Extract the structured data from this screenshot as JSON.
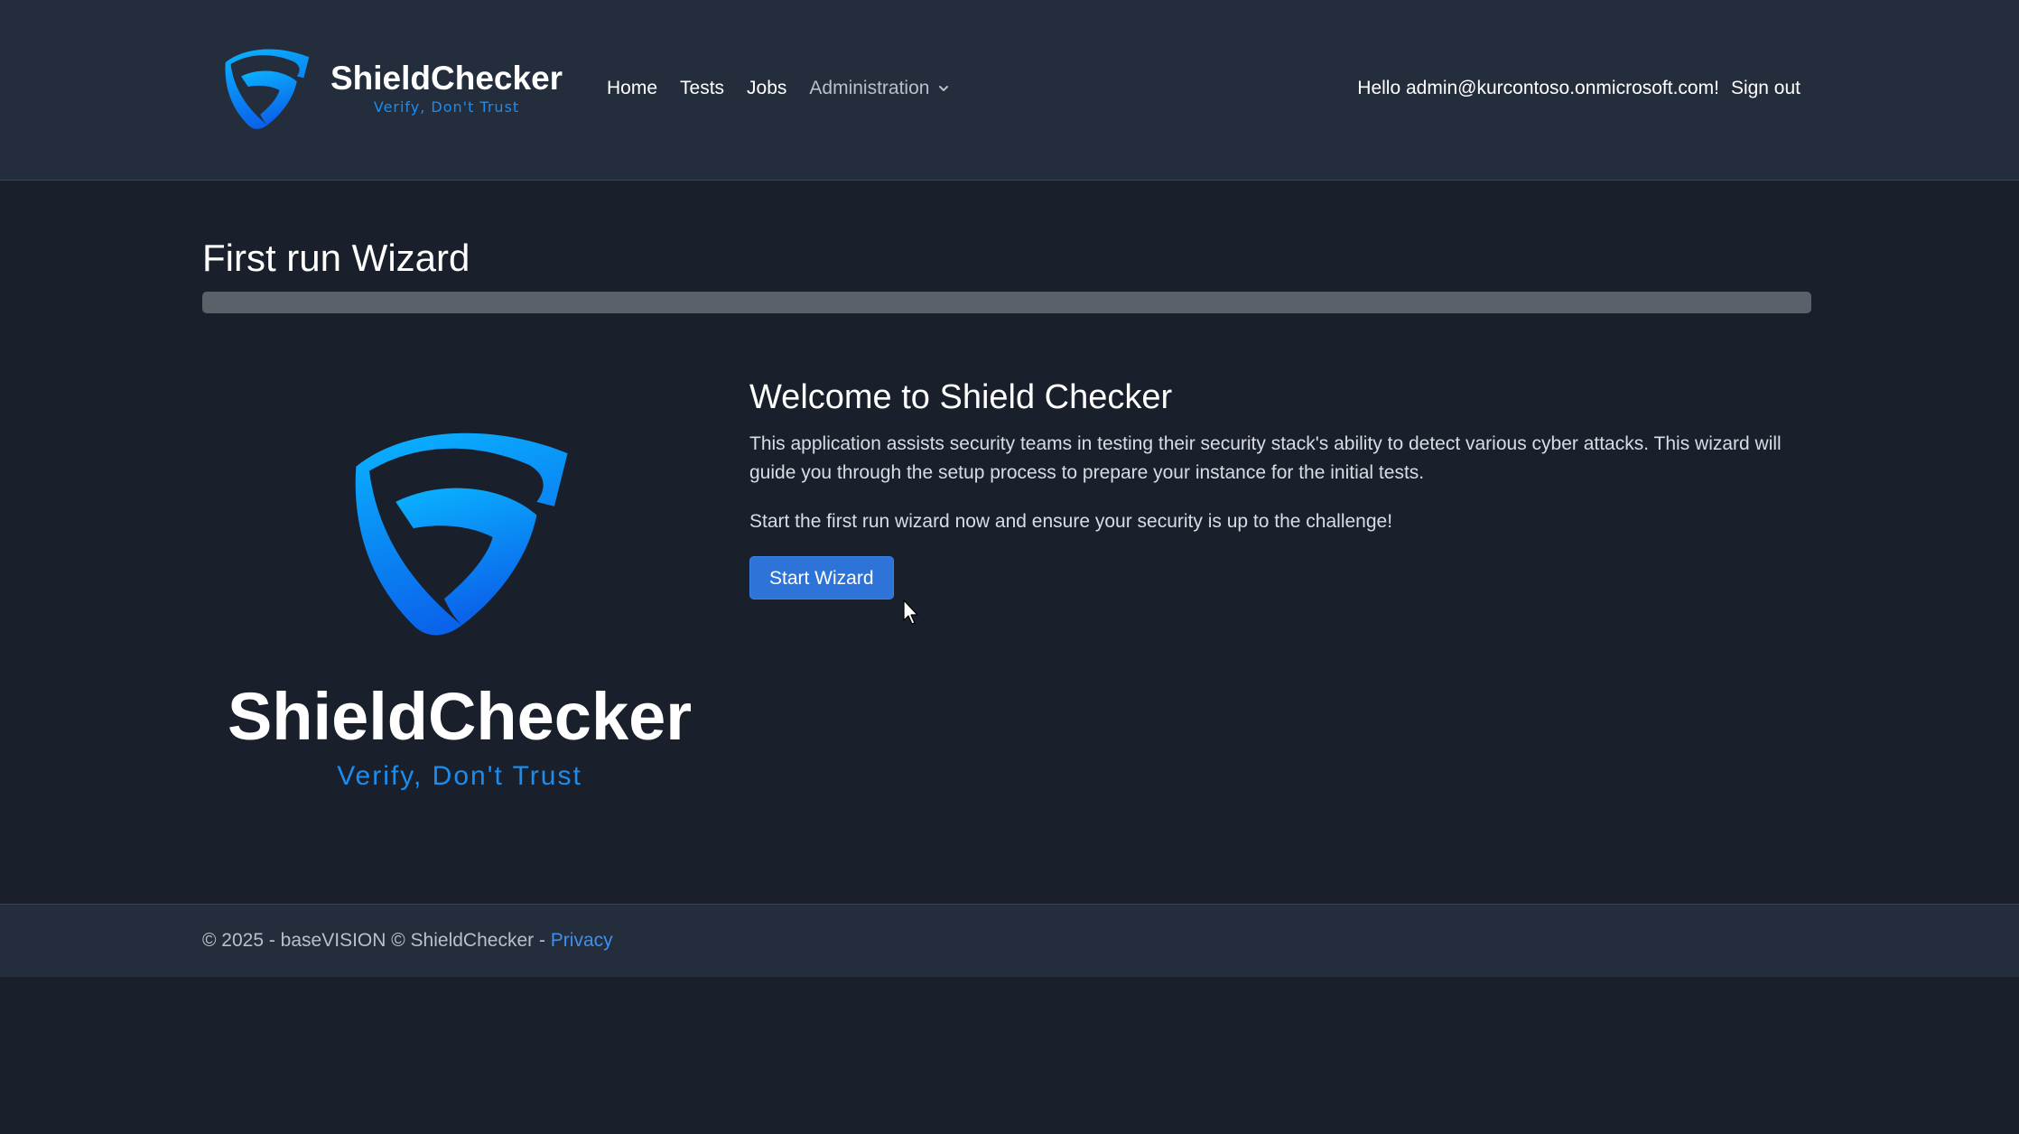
{
  "header": {
    "brand_name": "ShieldChecker",
    "brand_tagline": "Verify, Don't Trust",
    "nav": {
      "home": "Home",
      "tests": "Tests",
      "jobs": "Jobs",
      "administration": "Administration"
    },
    "greeting": "Hello admin@kurcontoso.onmicrosoft.com!",
    "signout": "Sign out"
  },
  "main": {
    "page_title": "First run Wizard",
    "progress_percent": 0,
    "hero_name": "ShieldChecker",
    "hero_tagline": "Verify, Don't Trust",
    "welcome_title": "Welcome to Shield Checker",
    "welcome_paragraph": "This application assists security teams in testing their security stack's ability to detect various cyber attacks. This wizard will guide you through the setup process to prepare your instance for the initial tests.",
    "welcome_paragraph_2": "Start the first run wizard now and ensure your security is up to the challenge!",
    "start_button": "Start Wizard"
  },
  "footer": {
    "copyright": "© 2025 - baseVISION © ShieldChecker - ",
    "privacy": "Privacy"
  },
  "colors": {
    "background": "#1a202b",
    "header_background": "#232d3b",
    "accent_blue": "#1b8df0",
    "button_blue": "#2e74d8",
    "progress_track": "#5b6169"
  },
  "icons": {
    "brand_logo": "shield-logo-icon",
    "dropdown": "chevron-down-icon",
    "cursor": "mouse-pointer-icon"
  }
}
